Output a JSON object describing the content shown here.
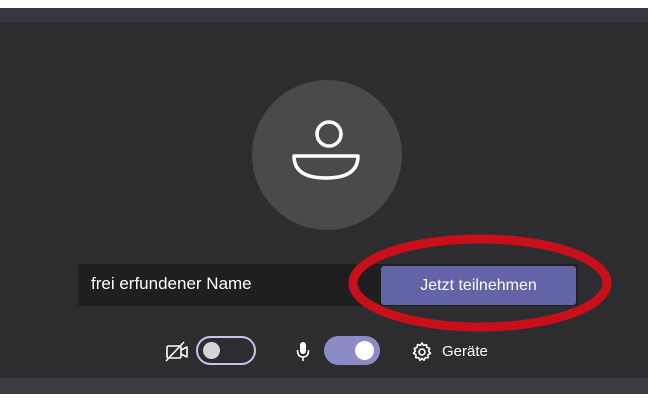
{
  "prejoin": {
    "name_value": "frei erfundener Name",
    "join_button_label": "Jetzt teilnehmen",
    "devices_label": "Geräte"
  },
  "toggles": {
    "camera_on": false,
    "microphone_on": true
  },
  "icons": {
    "avatar": "person-icon",
    "camera": "camera-off-icon",
    "microphone": "microphone-icon",
    "devices": "gear-icon"
  },
  "colors": {
    "background": "#2d2c2e",
    "accent": "#6264a7",
    "highlight": "#c8101a"
  }
}
